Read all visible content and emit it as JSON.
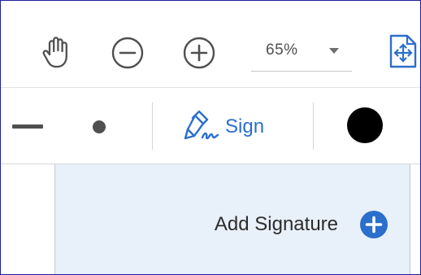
{
  "toolbar": {
    "hand_tool": {
      "icon": "hand-icon"
    },
    "zoom_out": {
      "icon": "zoom-out-icon"
    },
    "zoom_in": {
      "icon": "zoom-in-icon"
    },
    "zoom": {
      "value": "65%",
      "icon": "caret-down-icon"
    },
    "fit_page": {
      "icon": "fit-page-icon",
      "color": "#2b6fcc"
    }
  },
  "sign_toolbar": {
    "line_weight_thick": {
      "icon": "line-thickness-icon"
    },
    "line_weight_dot": {
      "icon": "dot-size-icon"
    },
    "sign": {
      "label": "Sign",
      "icon": "pen-signature-icon",
      "color": "#2b6fcc"
    },
    "ink_color": {
      "icon": "color-swatch",
      "color": "#000000"
    }
  },
  "signature_panel": {
    "add_signature_label": "Add Signature",
    "add_icon": "plus-circle-icon",
    "background": "#e8f0fa",
    "accent": "#2b6fcc"
  }
}
